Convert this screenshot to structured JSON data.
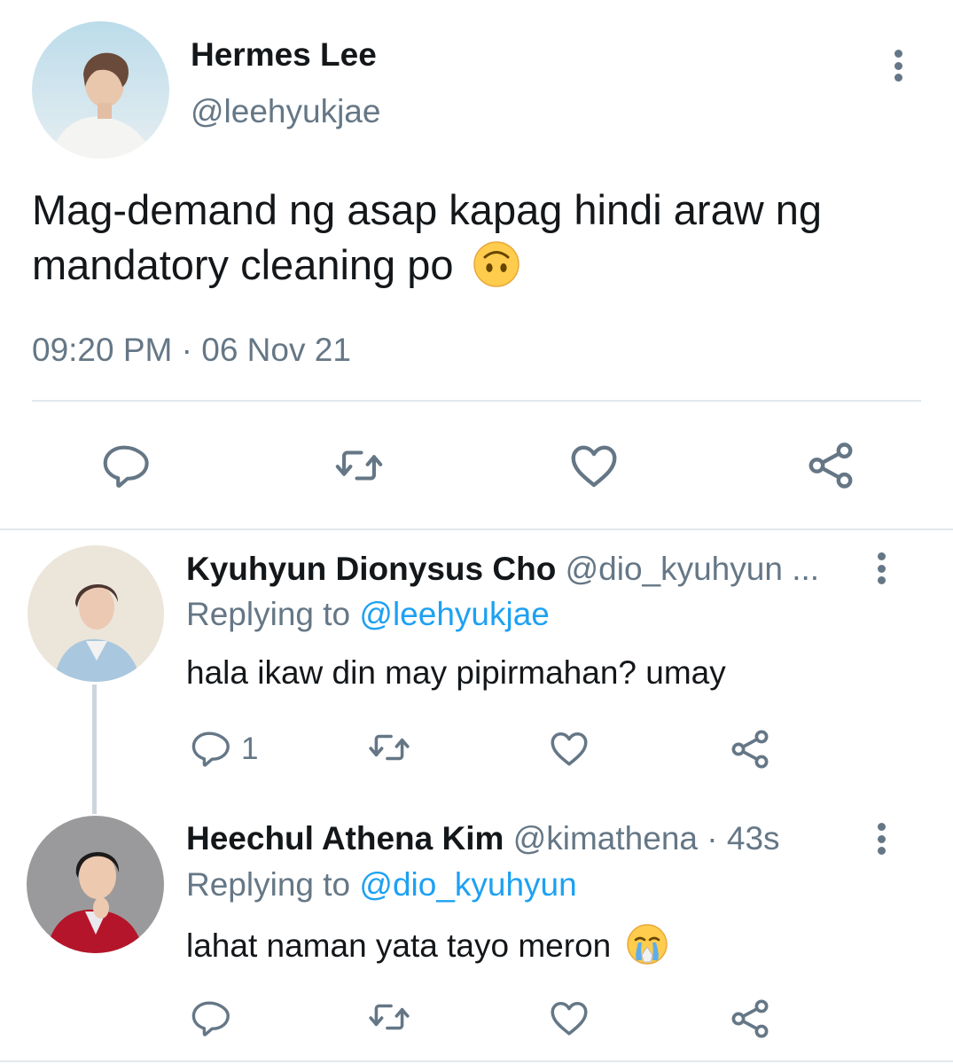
{
  "main_tweet": {
    "display_name": "Hermes Lee",
    "handle": "@leehyukjae",
    "text": "Mag-demand ng asap kapag hindi araw ng mandatory cleaning po",
    "emoji": "upside-down-face",
    "timestamp": "09:20 PM · 06 Nov 21"
  },
  "replies": [
    {
      "display_name": "Kyuhyun Dionysus Cho",
      "handle": "@dio_kyuhyun",
      "handle_suffix": "...",
      "replying_prefix": "Replying to",
      "replying_to": "@leehyukjae",
      "text": "hala ikaw din may pipirmahan? umay",
      "reply_count": "1"
    },
    {
      "display_name": "Heechul Athena Kim",
      "handle": "@kimathena",
      "time": "· 43s",
      "replying_prefix": "Replying to",
      "replying_to": "@dio_kyuhyun",
      "text": "lahat naman yata tayo meron",
      "emoji": "crying-face"
    }
  ],
  "colors": {
    "text": "#14171a",
    "secondary": "#657786",
    "link": "#1da1f2",
    "divider": "#e1e8ed"
  },
  "icons": [
    "reply-icon",
    "retweet-icon",
    "like-icon",
    "share-icon",
    "more-options-icon"
  ]
}
